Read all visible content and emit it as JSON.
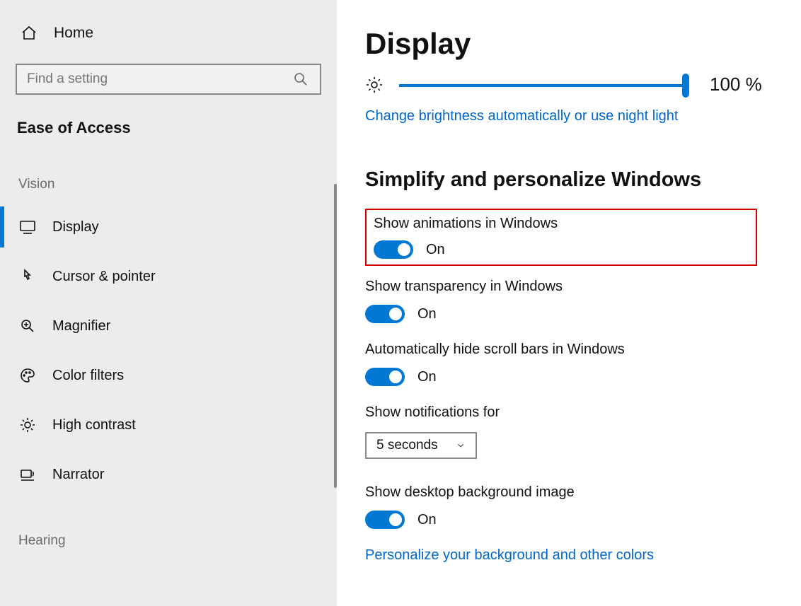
{
  "sidebar": {
    "home_label": "Home",
    "search_placeholder": "Find a setting",
    "section": "Ease of Access",
    "groups": [
      {
        "label": "Vision"
      },
      {
        "label": "Hearing"
      }
    ],
    "items": {
      "display": {
        "label": "Display"
      },
      "cursor": {
        "label": "Cursor & pointer"
      },
      "magnifier": {
        "label": "Magnifier"
      },
      "colorfilters": {
        "label": "Color filters"
      },
      "highcontrast": {
        "label": "High contrast"
      },
      "narrator": {
        "label": "Narrator"
      }
    }
  },
  "main": {
    "title": "Display",
    "brightness": {
      "value_label": "100 %"
    },
    "brightness_link": "Change brightness automatically or use night light",
    "section_heading": "Simplify and personalize Windows",
    "toggles": {
      "animations": {
        "label": "Show animations in Windows",
        "state": "On"
      },
      "transparency": {
        "label": "Show transparency in Windows",
        "state": "On"
      },
      "scrollbars": {
        "label": "Automatically hide scroll bars in Windows",
        "state": "On"
      },
      "desktopbg": {
        "label": "Show desktop background image",
        "state": "On"
      }
    },
    "notifications": {
      "label": "Show notifications for",
      "selected": "5 seconds"
    },
    "personalize_link": "Personalize your background and other colors"
  }
}
